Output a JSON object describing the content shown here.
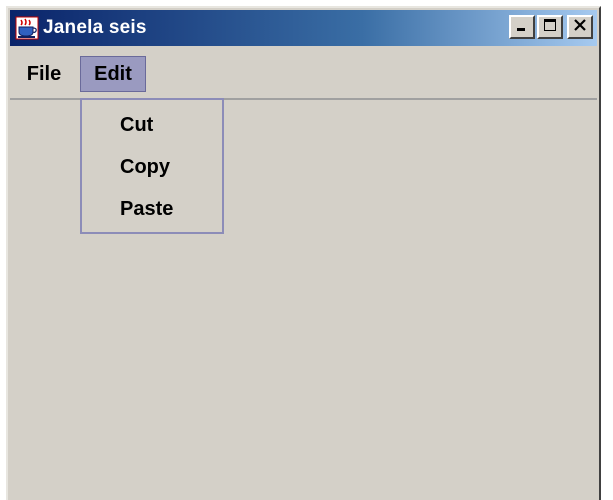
{
  "window": {
    "title": "Janela seis",
    "app_icon": "java-cup-icon"
  },
  "title_buttons": {
    "minimize_icon": "minimize-icon",
    "maximize_icon": "maximize-icon",
    "close_icon": "close-icon"
  },
  "menubar": {
    "items": [
      {
        "label": "File"
      },
      {
        "label": "Edit",
        "active": true
      }
    ]
  },
  "edit_menu": {
    "items": [
      {
        "label": "Cut"
      },
      {
        "label": "Copy"
      },
      {
        "label": "Paste"
      }
    ]
  },
  "colors": {
    "titlebar_start": "#0a246a",
    "titlebar_end": "#a6caf0",
    "window_bg": "#d4d0c8",
    "menu_highlight": "#9a9ac0"
  }
}
